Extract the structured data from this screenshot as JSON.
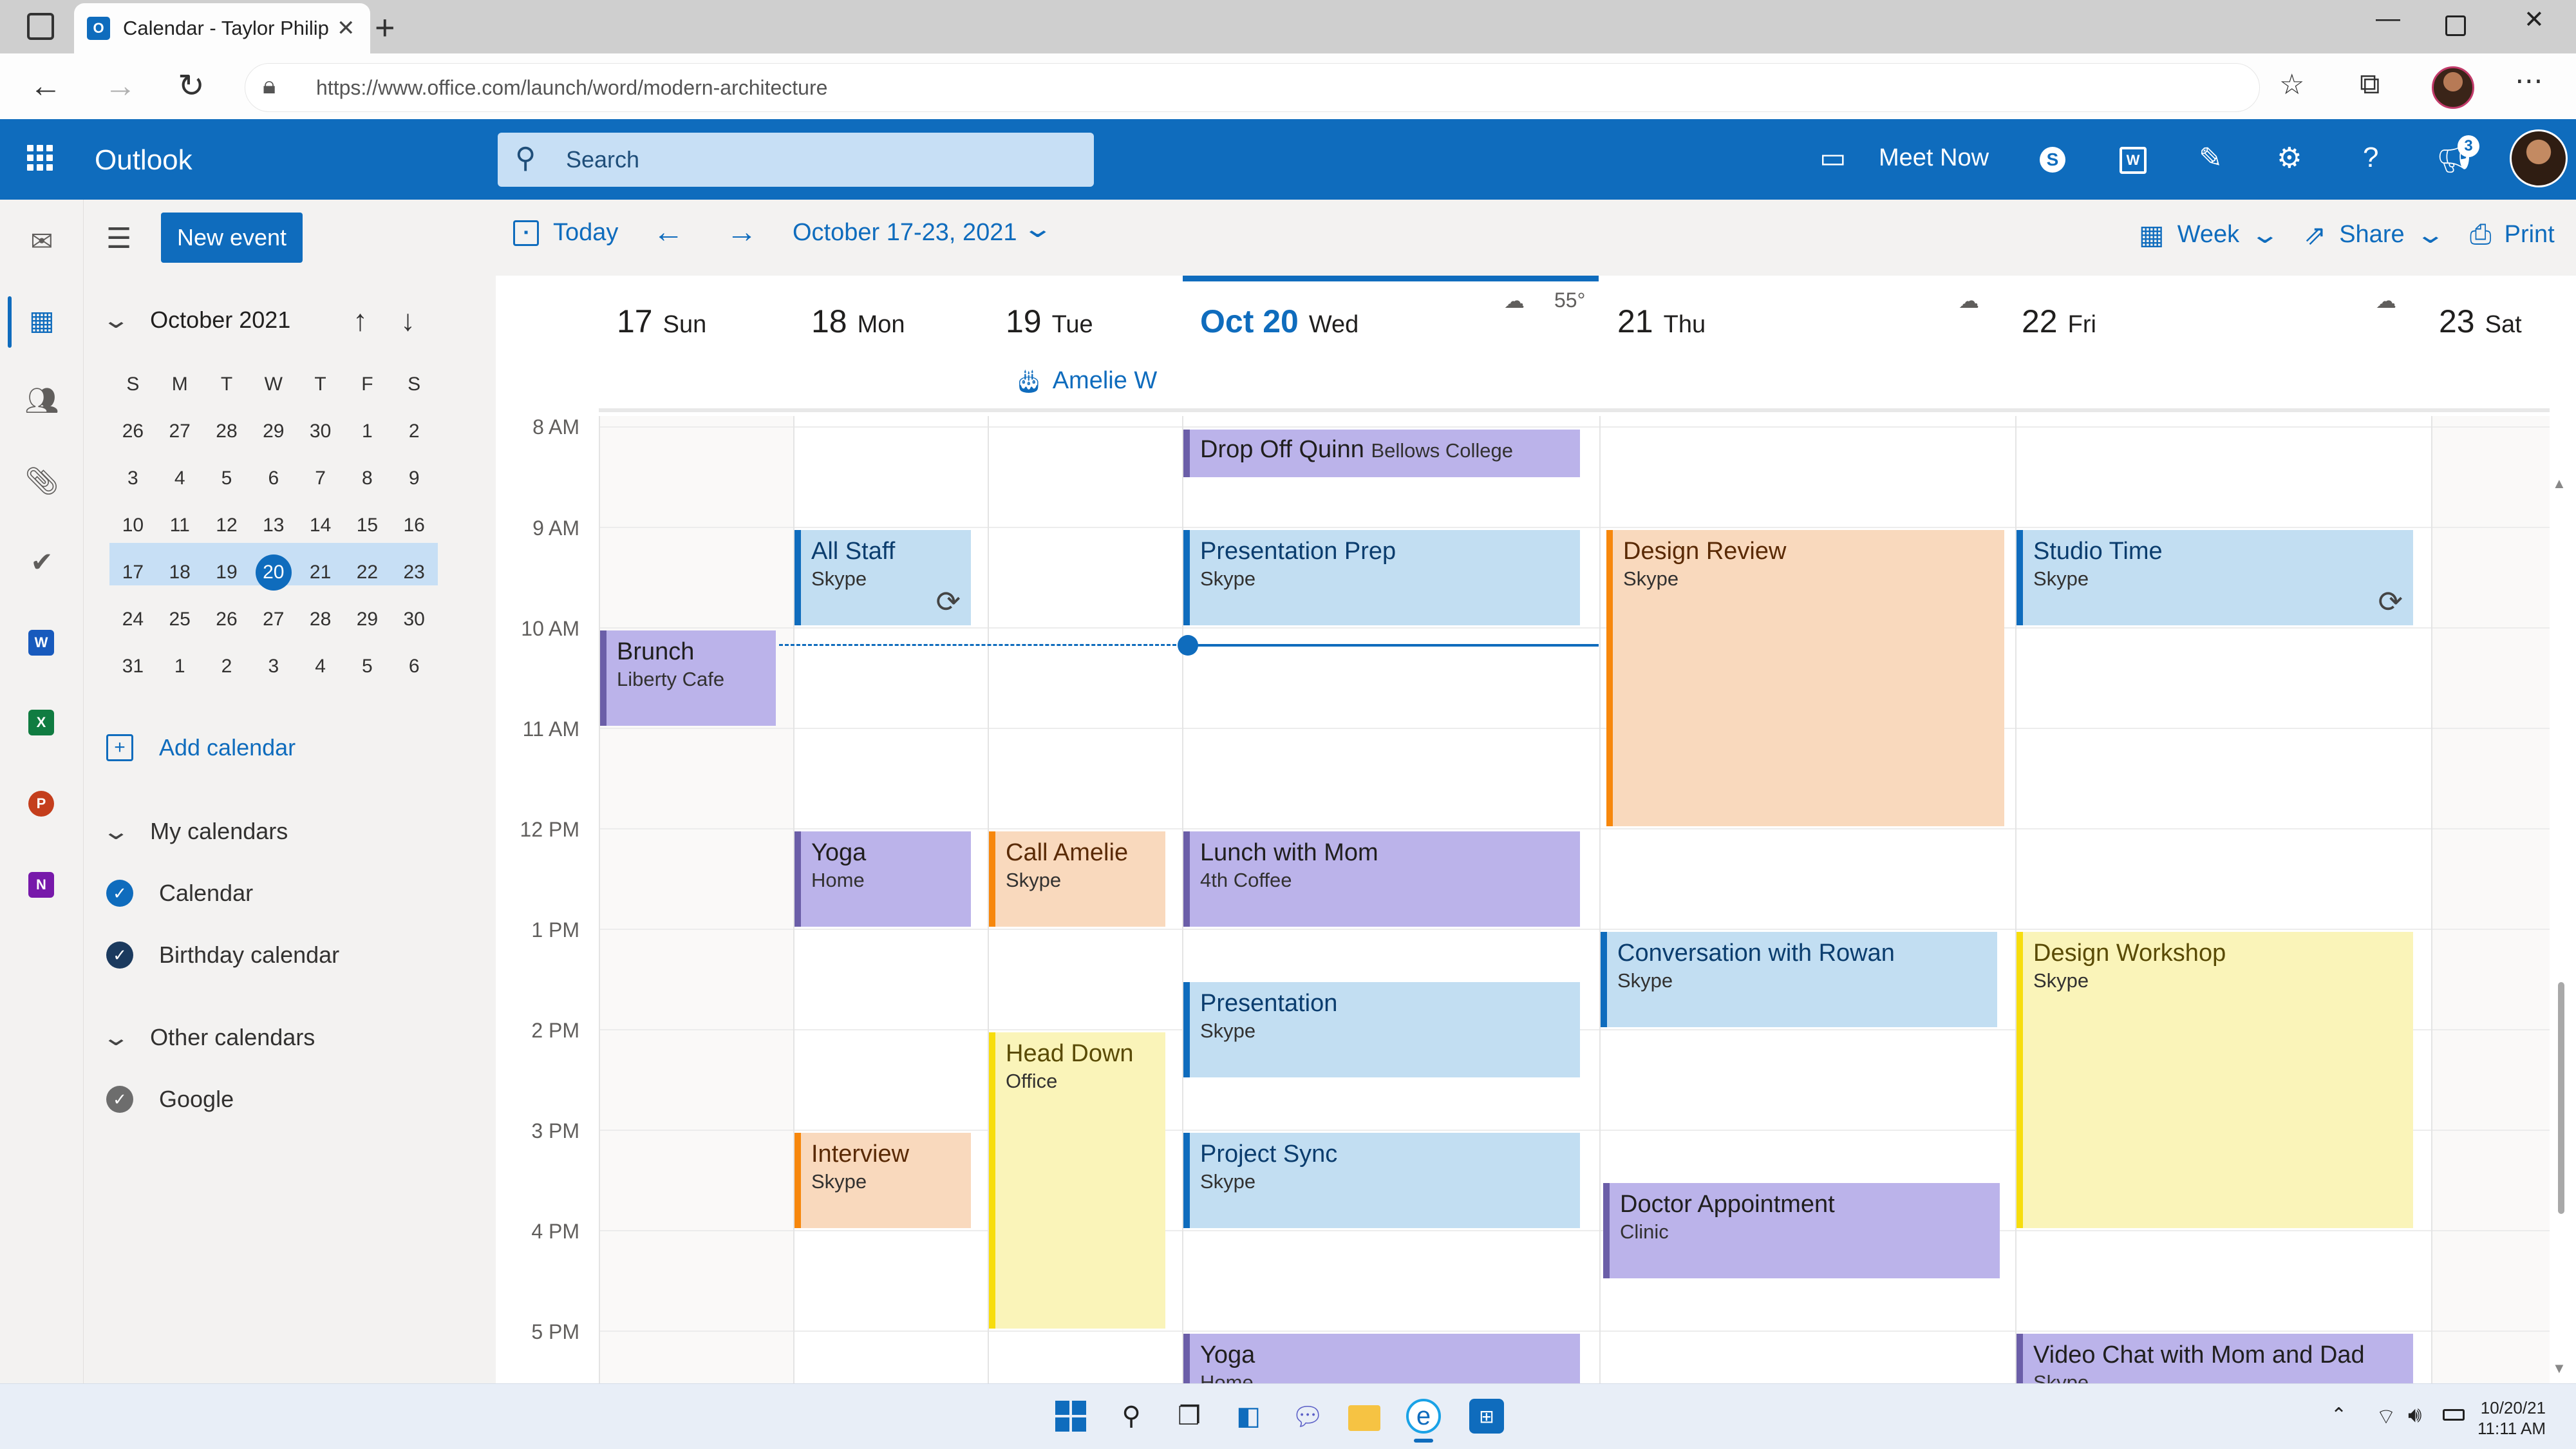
{
  "browser": {
    "tab_title": "Calendar - Taylor Philips",
    "url": "https://www.office.com/launch/word/modern-architecture"
  },
  "header": {
    "app_name": "Outlook",
    "search_placeholder": "Search",
    "meet_now": "Meet Now",
    "notification_count": "3"
  },
  "pane": {
    "new_event": "New event",
    "mini_month": "October 2021",
    "weekdays": [
      "S",
      "M",
      "T",
      "W",
      "T",
      "F",
      "S"
    ],
    "days": [
      "26",
      "27",
      "28",
      "29",
      "30",
      "1",
      "2",
      "3",
      "4",
      "5",
      "6",
      "7",
      "8",
      "9",
      "10",
      "11",
      "12",
      "13",
      "14",
      "15",
      "16",
      "17",
      "18",
      "19",
      "20",
      "21",
      "22",
      "23",
      "24",
      "25",
      "26",
      "27",
      "28",
      "29",
      "30",
      "31",
      "1",
      "2",
      "3",
      "4",
      "5",
      "6"
    ],
    "add_calendar": "Add calendar",
    "my_calendars": "My calendars",
    "calendar": "Calendar",
    "birthday_calendar": "Birthday calendar",
    "other_calendars": "Other calendars",
    "google": "Google"
  },
  "toolbar": {
    "today": "Today",
    "date_range": "October 17-23, 2021",
    "week": "Week",
    "share": "Share",
    "print": "Print"
  },
  "days": [
    {
      "num": "17",
      "name": "Sun"
    },
    {
      "num": "18",
      "name": "Mon"
    },
    {
      "num": "19",
      "name": "Tue"
    },
    {
      "num": "Oct 20",
      "name": "Wed"
    },
    {
      "num": "21",
      "name": "Thu"
    },
    {
      "num": "22",
      "name": "Fri"
    },
    {
      "num": "23",
      "name": "Sat"
    }
  ],
  "weather_temp": "55°",
  "birthday": "Amelie W",
  "hours": [
    "8 AM",
    "9 AM",
    "10 AM",
    "11 AM",
    "12 PM",
    "1 PM",
    "2 PM",
    "3 PM",
    "4 PM",
    "5 PM"
  ],
  "events": {
    "brunch": {
      "title": "Brunch",
      "sub": "Liberty Cafe"
    },
    "all_staff": {
      "title": "All Staff",
      "sub": "Skype"
    },
    "yoga_mon": {
      "title": "Yoga",
      "sub": "Home"
    },
    "interview": {
      "title": "Interview",
      "sub": "Skype"
    },
    "call_amelie": {
      "title": "Call Amelie",
      "sub": "Skype"
    },
    "head_down": {
      "title": "Head Down",
      "sub": "Office"
    },
    "drop_off": {
      "title": "Drop Off Quinn",
      "sub": "Bellows College"
    },
    "pres_prep": {
      "title": "Presentation Prep",
      "sub": "Skype"
    },
    "lunch": {
      "title": "Lunch with Mom",
      "sub": "4th Coffee"
    },
    "presentation": {
      "title": "Presentation",
      "sub": "Skype"
    },
    "project_sync": {
      "title": "Project Sync",
      "sub": "Skype"
    },
    "yoga_wed": {
      "title": "Yoga",
      "sub": "Home"
    },
    "design_review": {
      "title": "Design Review",
      "sub": "Skype"
    },
    "conversation": {
      "title": "Conversation with Rowan",
      "sub": "Skype"
    },
    "doctor": {
      "title": "Doctor Appointment",
      "sub": "Clinic"
    },
    "studio": {
      "title": "Studio Time",
      "sub": "Skype"
    },
    "workshop": {
      "title": "Design Workshop",
      "sub": "Skype"
    },
    "video_chat": {
      "title": "Video Chat with Mom and Dad",
      "sub": "Skype"
    }
  },
  "clock": {
    "date": "10/20/21",
    "time": "11:11 AM"
  },
  "colors": {
    "brand": "#0f6cbd",
    "purple": "#bbb3ea",
    "blue": "#c2def2",
    "orange": "#f9d9bd",
    "yellow": "#faf4b9"
  }
}
